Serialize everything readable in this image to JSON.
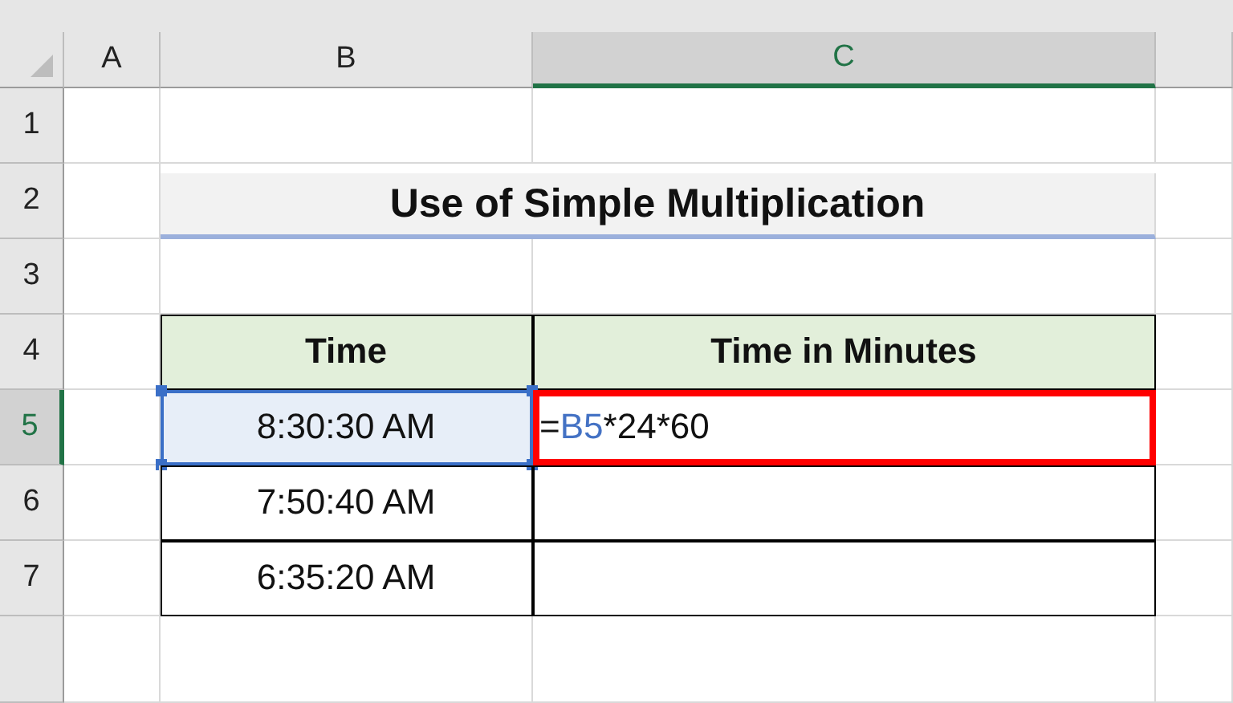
{
  "column_headers": [
    {
      "label": "A",
      "selected": false
    },
    {
      "label": "B",
      "selected": false
    },
    {
      "label": "C",
      "selected": true
    }
  ],
  "rows": [
    {
      "label": "1",
      "selected": false,
      "cells": []
    },
    {
      "label": "2",
      "selected": false,
      "cells": [
        {
          "kind": "title",
          "text": "Use of Simple Multiplication"
        }
      ]
    },
    {
      "label": "3",
      "selected": false,
      "cells": []
    },
    {
      "label": "4",
      "selected": false,
      "cells": [
        {
          "kind": "header",
          "text": "Time"
        },
        {
          "kind": "header",
          "text": "Time in Minutes"
        }
      ]
    },
    {
      "label": "5",
      "selected": true,
      "cells": [
        {
          "kind": "data",
          "text": "8:30:30 AM",
          "selected": true
        },
        {
          "kind": "formula",
          "highlighted": true,
          "parts": [
            {
              "kind": "plain",
              "text": "="
            },
            {
              "kind": "ref",
              "text": "B5"
            },
            {
              "kind": "plain",
              "text": "*24*60"
            }
          ]
        }
      ]
    },
    {
      "label": "6",
      "selected": false,
      "cells": [
        {
          "kind": "data",
          "text": "7:50:40 AM",
          "selected": false
        },
        {
          "kind": "data",
          "selected": false
        }
      ]
    },
    {
      "label": "7",
      "selected": false,
      "cells": [
        {
          "kind": "data",
          "text": "6:35:20 AM",
          "selected": false
        },
        {
          "kind": "data",
          "selected": false
        }
      ]
    }
  ]
}
